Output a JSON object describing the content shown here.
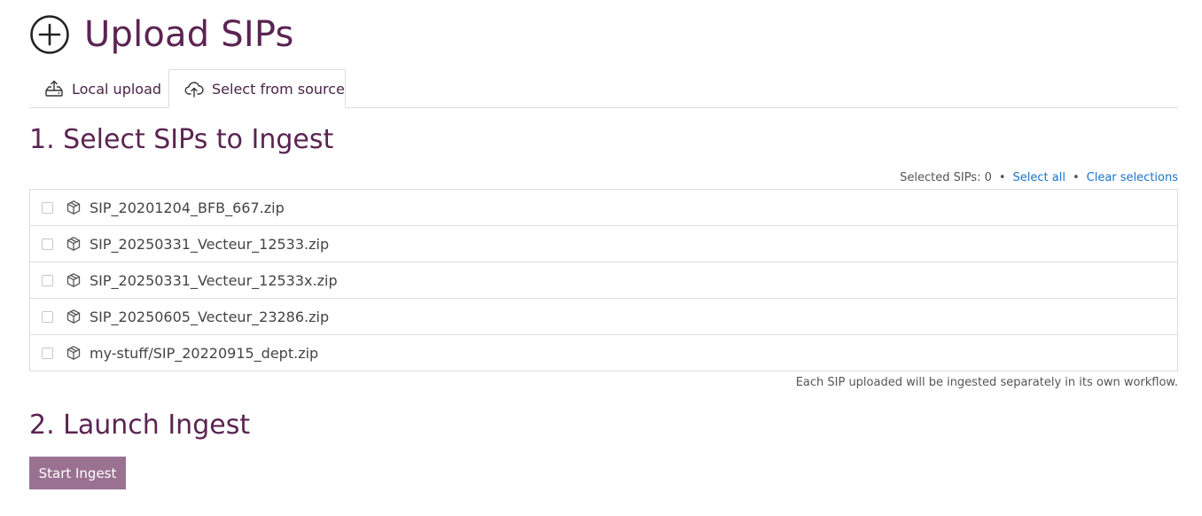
{
  "header": {
    "title": "Upload SIPs",
    "icon": "plus-circle-icon"
  },
  "tabs": [
    {
      "label": "Local upload",
      "icon": "upload-tray-icon",
      "active": false
    },
    {
      "label": "Select from source",
      "icon": "cloud-upload-icon",
      "active": true
    }
  ],
  "section1": {
    "title": "1. Select SIPs to Ingest",
    "selected_label": "Selected SIPs: 0",
    "separator": "•",
    "select_all": "Select all",
    "clear_selections": "Clear selections"
  },
  "sips": [
    {
      "name": "SIP_20201204_BFB_667.zip",
      "checked": false,
      "icon": "package-icon"
    },
    {
      "name": "SIP_20250331_Vecteur_12533.zip",
      "checked": false,
      "icon": "package-icon"
    },
    {
      "name": "SIP_20250331_Vecteur_12533x.zip",
      "checked": false,
      "icon": "package-icon"
    },
    {
      "name": "SIP_20250605_Vecteur_23286.zip",
      "checked": false,
      "icon": "package-icon"
    },
    {
      "name": "my-stuff/SIP_20220915_dept.zip",
      "checked": false,
      "icon": "package-icon"
    }
  ],
  "note": "Each SIP uploaded will be ingested separately in its own workflow.",
  "section2": {
    "title": "2. Launch Ingest",
    "button_label": "Start Ingest"
  },
  "colors": {
    "heading": "#5b2451",
    "link": "#1a73c9",
    "button": "#9b7191",
    "border": "#dddddd"
  }
}
